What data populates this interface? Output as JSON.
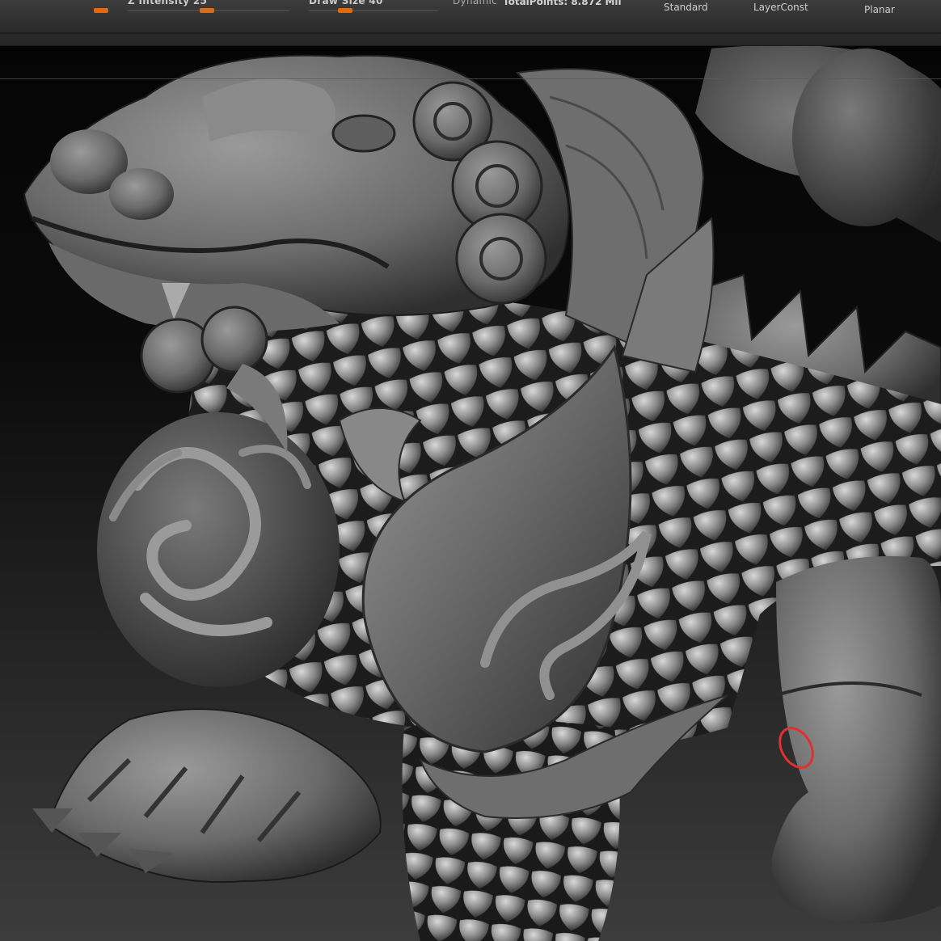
{
  "toolbar": {
    "z_intensity_label": "Z Intensity 25",
    "draw_size_label": "Draw Size 40",
    "dynamic_label": "Dynamic",
    "total_points": "TotalPoints: 8.872 Mil",
    "brushes": [
      {
        "label": "Standard"
      },
      {
        "label": "LayerConst"
      },
      {
        "label": "Planar"
      }
    ]
  },
  "viewport": {
    "subject": "sculpted-guardian-lion-model",
    "brush_cursor_color": "#e03030"
  },
  "colors": {
    "accent": "#e06a10",
    "background": "#0b0b0b",
    "clay": "#7a7a7a"
  }
}
